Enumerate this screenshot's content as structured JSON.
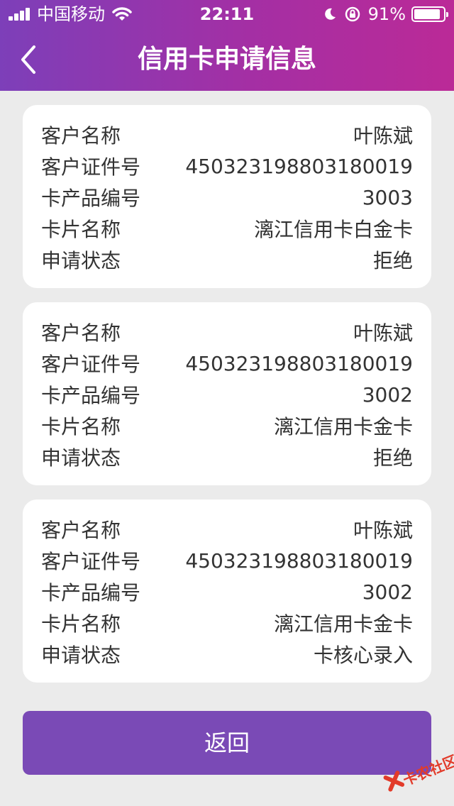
{
  "status_bar": {
    "carrier": "中国移动",
    "time": "22:11",
    "battery_text": "91%",
    "battery_level": 0.91
  },
  "header": {
    "title": "信用卡申请信息"
  },
  "cards": [
    {
      "rows": [
        {
          "label": "客户名称",
          "value": "叶陈斌"
        },
        {
          "label": "客户证件号",
          "value": "450323198803180019"
        },
        {
          "label": "卡产品编号",
          "value": "3003"
        },
        {
          "label": "卡片名称",
          "value": "漓江信用卡白金卡"
        },
        {
          "label": "申请状态",
          "value": "拒绝"
        }
      ]
    },
    {
      "rows": [
        {
          "label": "客户名称",
          "value": "叶陈斌"
        },
        {
          "label": "客户证件号",
          "value": "450323198803180019"
        },
        {
          "label": "卡产品编号",
          "value": "3002"
        },
        {
          "label": "卡片名称",
          "value": "漓江信用卡金卡"
        },
        {
          "label": "申请状态",
          "value": "拒绝"
        }
      ]
    },
    {
      "rows": [
        {
          "label": "客户名称",
          "value": "叶陈斌"
        },
        {
          "label": "客户证件号",
          "value": "450323198803180019"
        },
        {
          "label": "卡产品编号",
          "value": "3002"
        },
        {
          "label": "卡片名称",
          "value": "漓江信用卡金卡"
        },
        {
          "label": "申请状态",
          "value": "卡核心录入"
        }
      ]
    }
  ],
  "footer": {
    "return_label": "返回"
  },
  "watermark": {
    "text": "卡农社区"
  },
  "colors": {
    "header_gradient_start": "#7d3fb9",
    "header_gradient_end": "#bb2a97",
    "button_bg": "#7a4ab6",
    "page_bg": "#ebebeb"
  }
}
